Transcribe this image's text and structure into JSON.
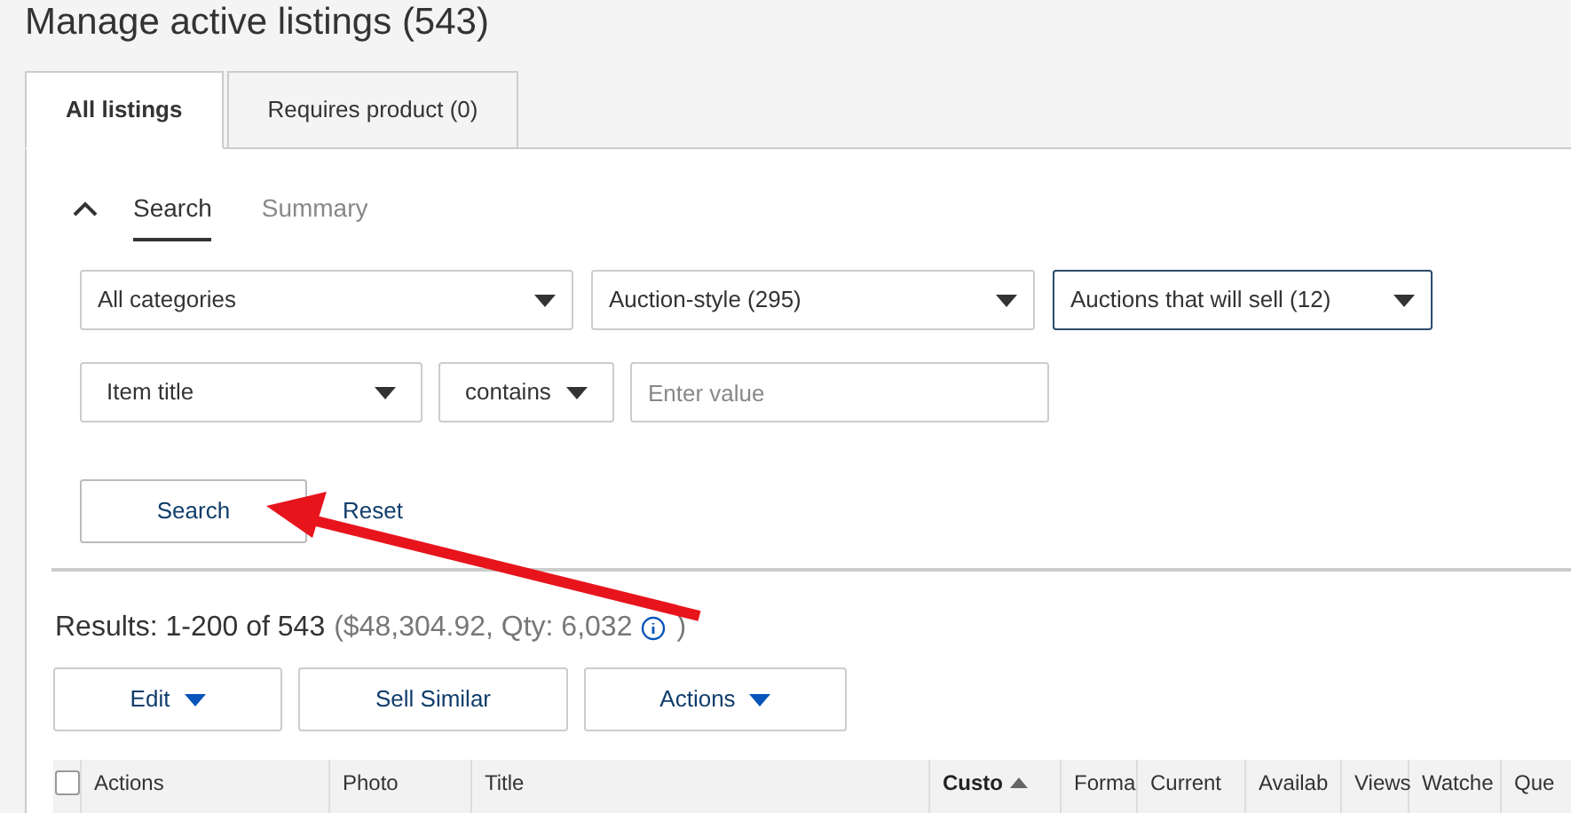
{
  "page_title": "Manage active listings (543)",
  "tabs": [
    {
      "label": "All listings",
      "selected": true
    },
    {
      "label": "Requires product (0)",
      "selected": false
    }
  ],
  "search_panel": {
    "expanded": true,
    "subtabs": [
      {
        "label": "Search",
        "selected": true
      },
      {
        "label": "Summary",
        "selected": false
      }
    ],
    "filters": [
      {
        "value": "All categories",
        "focused": false
      },
      {
        "value": "Auction-style (295)",
        "focused": false
      },
      {
        "value": "Auctions that will sell (12)",
        "focused": true
      }
    ],
    "field_select": "Item title",
    "operator_select": "contains",
    "value_field": {
      "placeholder": "Enter value"
    },
    "search_button": "Search",
    "reset_link": "Reset"
  },
  "results": {
    "summary": "Results: 1-200 of 543",
    "totals": "($48,304.92, Qty: 6,032",
    "closing": ")"
  },
  "action_buttons": [
    {
      "label": "Edit",
      "dropdown": true
    },
    {
      "label": "Sell Similar",
      "dropdown": false
    },
    {
      "label": "Actions",
      "dropdown": true
    }
  ],
  "table": {
    "select_all_checked": false,
    "columns": [
      {
        "label": "Actions",
        "sorted": false
      },
      {
        "label": "Photo",
        "sorted": false
      },
      {
        "label": "Title",
        "sorted": false
      },
      {
        "label": "Custo",
        "sorted": true
      },
      {
        "label": "Forma",
        "sorted": false
      },
      {
        "label": "Current",
        "sorted": false
      },
      {
        "label": "Availab",
        "sorted": false
      },
      {
        "label": "Views",
        "sorted": false
      },
      {
        "label": "Watche",
        "sorted": false
      },
      {
        "label": "Que",
        "sorted": false
      }
    ]
  }
}
